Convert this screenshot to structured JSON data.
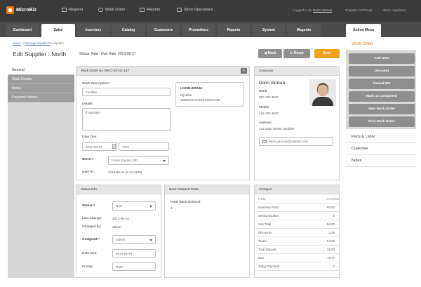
{
  "app": {
    "name": "MicroBiz"
  },
  "topnav": [
    {
      "label": "Register",
      "icon": "register-icon"
    },
    {
      "label": "Work Order",
      "icon": "wrench-icon"
    },
    {
      "label": "Reports",
      "icon": "chart-icon"
    },
    {
      "label": "Store Operations",
      "icon": "store-icon"
    }
  ],
  "session": {
    "logged_in_prefix": "Logged in as:",
    "user": "Dorin Vancea",
    "register_label": "Register: APPReg1",
    "store_label": "Store: Appliance"
  },
  "tabs": [
    "Dashboard",
    "Sales",
    "Inventory",
    "Catalog",
    "Customers",
    "Promotions",
    "Reports",
    "System",
    "Magento"
  ],
  "action_menu_tab": "Action Menu",
  "breadcrumb": {
    "home": "Home",
    "sep": ">",
    "parent": "Manage Suppliers",
    "current": "Update"
  },
  "page": {
    "title": "Edit Supplier : North",
    "status_label": "Status:",
    "status_value": "New",
    "due_label": "Due Date:",
    "due_value": "2013-06-27"
  },
  "buttons": {
    "back": "Back",
    "reset": "Reset",
    "save": "Save"
  },
  "sidenav": [
    "General",
    "Work Details",
    "Notes",
    "Payment History"
  ],
  "work_order": {
    "header": "Work Order No WKO-SF-01-127",
    "desc_label": "Work Description:*",
    "desc_value": "Fix Bike",
    "details_label": "Details:",
    "details_value": "it squeaks",
    "locid_title": "LOCID-905145",
    "locid_item": "My Bike",
    "locid_code": "10020011787554HGSCCC00",
    "date_due_label": "Date Due:",
    "date_due_value": "2013-06-24",
    "time_placeholder": "Time",
    "store_label": "Store:*",
    "store_value": "Union Square, SF",
    "date_in_label": "Date In:",
    "date_in_value": "2013-06-24 at 12:41PM"
  },
  "customer": {
    "header": "Customer",
    "name": "Dorin Vancea",
    "work_label": "Work:",
    "work_value": "550 123 4567",
    "mobile_label": "Mobile:",
    "mobile_value": "415 123 4567",
    "address_label": "Address:",
    "address_value": "123 Main Street, Boulder",
    "email": "dorin.vancea@outlook.com"
  },
  "status_info": {
    "header": "Status Info",
    "status_label": "Status:*",
    "status_value": "New",
    "last_change_label": "Last Change:",
    "last_change_value": "2013-06-24",
    "changed_by_label": "Changed by:",
    "changed_by_value": "admin",
    "assigned_label": "Assigned:*",
    "assigned_value": "Admin",
    "date_due_label": "Date Due:",
    "date_due_value": "2013-06-24",
    "priority_label": "Priority:",
    "priority_value": "Rush"
  },
  "back_ordered": {
    "header": "Back Ordered Parts",
    "label": "Parts Back Ordered:",
    "value": "1"
  },
  "charges": {
    "header": "Charges",
    "col_item": "ITEM",
    "col_charges": "CHARGES",
    "rows": [
      {
        "item": "Inventory Parts",
        "value": "94.00"
      },
      {
        "item": "Services/Labor",
        "value": "0"
      },
      {
        "item": "Sub Total",
        "value": "94.00"
      },
      {
        "item": "Discounts",
        "value": "2.25"
      },
      {
        "item": "Taxes",
        "value": "8.028"
      },
      {
        "item": "Total Deposit",
        "value": "25.00"
      },
      {
        "item": "Due",
        "value": "75.77"
      },
      {
        "item": "Today Payment",
        "value": "0"
      }
    ]
  },
  "action_menu": {
    "header": "Work Order",
    "buttons": [
      "Add Note",
      "Discount",
      "Cancel WO",
      "Mark as Completed",
      "New Work Order",
      "Find Work Order"
    ],
    "sections": [
      "Parts & Labor",
      "Customer",
      "Notes"
    ]
  },
  "colors": {
    "accent": "#f0a21b",
    "topbar": "#3a3a3a",
    "tabbar": "#4b4b4b"
  }
}
